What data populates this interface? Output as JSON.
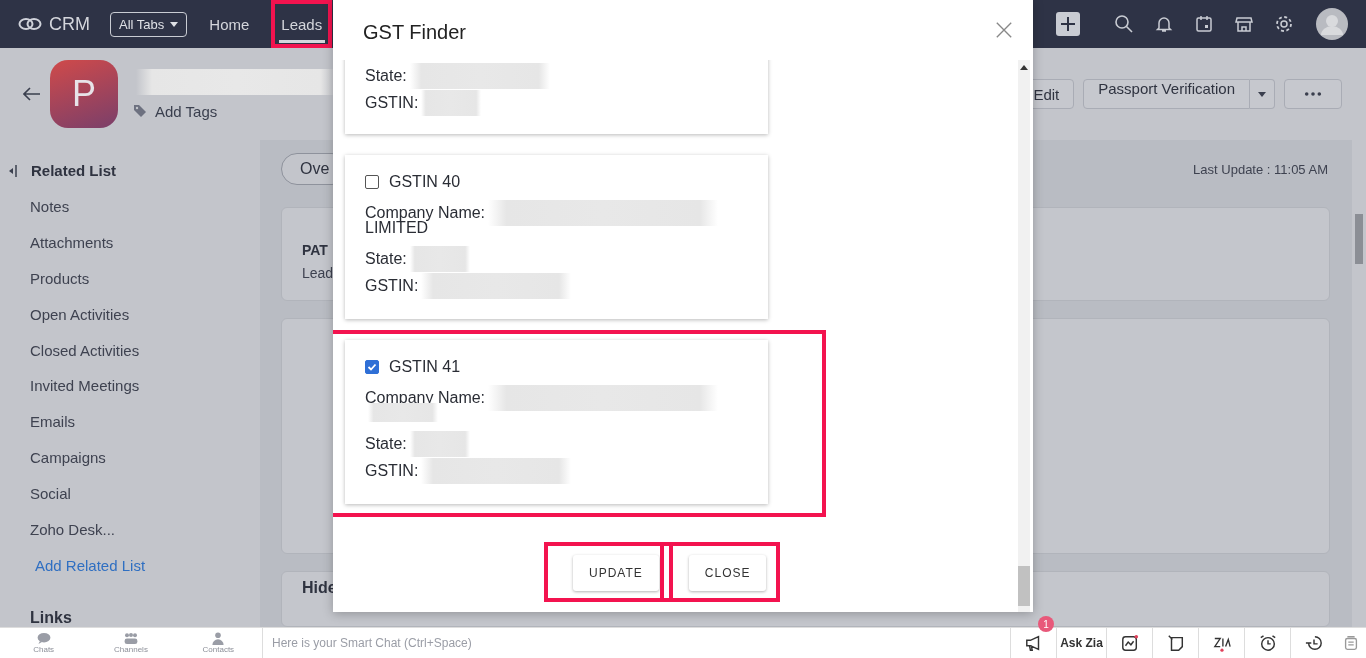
{
  "top_bar": {
    "logo": "CRM",
    "all_tabs": "All Tabs",
    "tabs": [
      {
        "label": "Home",
        "selected": false,
        "highlighted": false
      },
      {
        "label": "Leads",
        "selected": true,
        "highlighted": true
      }
    ]
  },
  "record": {
    "avatar_letter": "P",
    "add_tags": "Add Tags",
    "edit": "Edit",
    "split_action": "Passport Verification"
  },
  "sidebar": {
    "title": "Related List",
    "items": [
      "Notes",
      "Attachments",
      "Products",
      "Open Activities",
      "Closed Activities",
      "Invited Meetings",
      "Emails",
      "Campaigns",
      "Social",
      "Zoho Desk..."
    ],
    "add_link": "Add Related List",
    "links_title": "Links"
  },
  "content": {
    "tab": "Ove",
    "last_update": "Last Update : 11:05 AM",
    "path_title": "PAT",
    "path_sub": "Lead",
    "hide_details": "Hide"
  },
  "modal": {
    "title": "GST Finder",
    "cards": [
      {
        "kind": "partial",
        "fields": [
          {
            "label": "State:"
          },
          {
            "label": "GSTIN:"
          }
        ]
      },
      {
        "kind": "full",
        "title": "GSTIN 40",
        "checked": false,
        "highlighted": false,
        "fields": [
          {
            "label": "Company Name:",
            "continuation": "LIMITED"
          },
          {
            "label": "State:"
          },
          {
            "label": "GSTIN:"
          }
        ]
      },
      {
        "kind": "full",
        "title": "GSTIN 41",
        "checked": true,
        "highlighted": true,
        "fields": [
          {
            "label": "Company Name:"
          },
          {
            "label": "State:"
          },
          {
            "label": "GSTIN:"
          }
        ]
      }
    ],
    "buttons": [
      {
        "label": "UPDATE",
        "highlighted": true
      },
      {
        "label": "CLOSE",
        "highlighted": true
      }
    ]
  },
  "bottom_bar": {
    "nav": [
      "Chats",
      "Channels",
      "Contacts"
    ],
    "chat_placeholder": "Here is your Smart Chat (Ctrl+Space)",
    "notification_count": "1",
    "ask_zia": "Ask Zia"
  }
}
